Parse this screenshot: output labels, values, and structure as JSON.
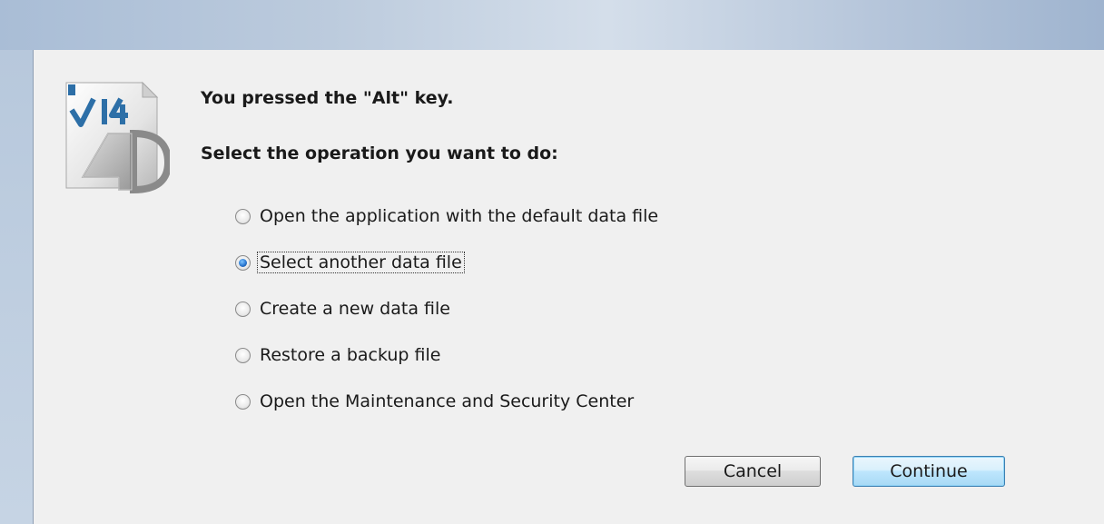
{
  "dialog": {
    "message": "You pressed the \"Alt\" key.",
    "prompt": "Select the operation you want to do:",
    "logo_text": "v14",
    "options": [
      {
        "label": "Open the application with the default data file",
        "checked": false
      },
      {
        "label": "Select another data file",
        "checked": true
      },
      {
        "label": "Create a new data file",
        "checked": false
      },
      {
        "label": "Restore a backup file",
        "checked": false
      },
      {
        "label": "Open the Maintenance and Security Center",
        "checked": false
      }
    ],
    "buttons": {
      "cancel_label": "Cancel",
      "continue_label": "Continue"
    }
  },
  "colors": {
    "dialog_background": "#f0f0f0",
    "titlebar": "#bccbdd",
    "radio_selected": "#2a78d1",
    "default_button_border": "#3c7fb1"
  }
}
